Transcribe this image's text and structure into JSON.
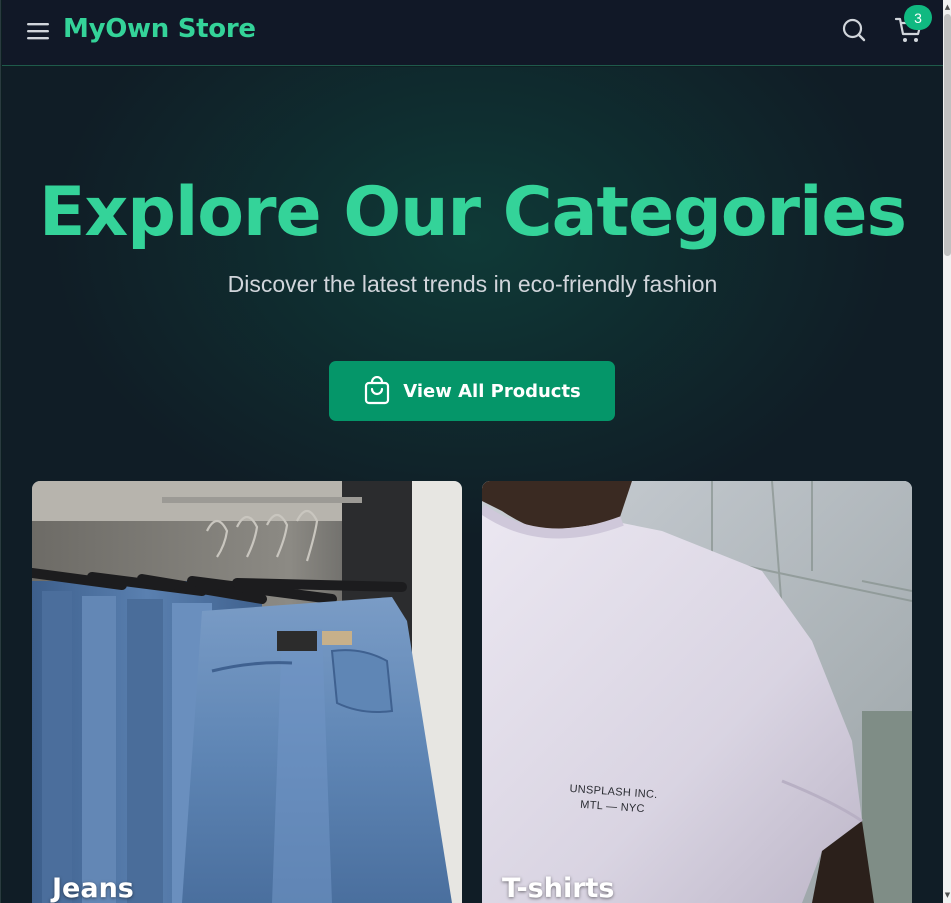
{
  "header": {
    "brand": "MyOwn Store",
    "menu_icon": "hamburger-menu-icon",
    "search_icon": "search-icon",
    "cart_icon": "shopping-cart-icon",
    "cart_count": "3"
  },
  "hero": {
    "title": "Explore Our Categories",
    "subtitle": "Discover the latest trends in eco-friendly fashion",
    "cta": {
      "label": "View All Products",
      "icon": "shopping-bag-icon"
    }
  },
  "categories": [
    {
      "label": "Jeans"
    },
    {
      "label": "T-shirts",
      "shirt_print": [
        "UNSPLASH INC.",
        "MTL — NYC"
      ]
    }
  ],
  "colors": {
    "accent": "#34d399",
    "button": "#059669",
    "header_bg": "#111827",
    "badge": "#10b981"
  }
}
